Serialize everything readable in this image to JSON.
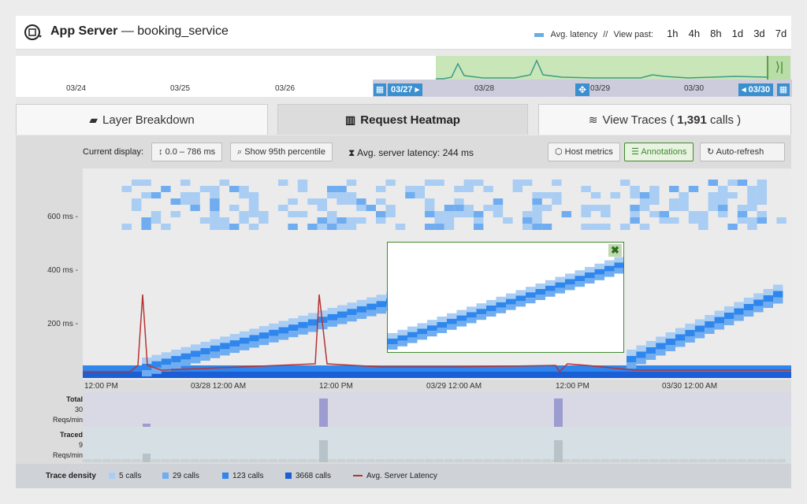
{
  "header": {
    "app_name": "App Server",
    "service": "booking_service",
    "legend_label": "Avg. latency",
    "separator": "//",
    "view_past_label": "View past:",
    "ranges": [
      "1h",
      "4h",
      "8h",
      "1d",
      "3d",
      "7d"
    ]
  },
  "timeline": {
    "dates": [
      "03/24",
      "03/25",
      "03/26",
      "03/28",
      "03/29",
      "03/30"
    ],
    "start_tag": "03/27",
    "end_tag": "03/30",
    "handle_glyph": "⟩|",
    "accent": "#3a8fcf",
    "selection_color": "#c8e6b8"
  },
  "tabs": [
    {
      "label": "Layer Breakdown",
      "icon": "layers-icon"
    },
    {
      "label": "Request Heatmap",
      "icon": "heatmap-icon"
    },
    {
      "label": "View Traces ( ",
      "count": "1,391",
      "suffix": " calls )",
      "icon": "traces-icon"
    }
  ],
  "toolbar": {
    "current_display_label": "Current display:",
    "range_value": "0.0 – 786 ms",
    "percentile_btn": "Show 95th percentile",
    "avg_latency_text": "Avg. server latency: 244 ms",
    "host_metrics_btn": "Host metrics",
    "annotations_btn": "Annotations",
    "auto_refresh_btn": "Auto-refresh"
  },
  "heatmap": {
    "y_ticks": [
      "600 ms -",
      "400 ms -",
      "200 ms -"
    ],
    "x_ticks": [
      "12:00 PM",
      "03/28 12:00 AM",
      "12:00 PM",
      "03/29 12:00 AM",
      "12:00 PM",
      "03/30 12:00 AM"
    ],
    "close_glyph": "✖",
    "line_color": "#b83232"
  },
  "strips": {
    "total_title": "Total",
    "total_value": "30",
    "total_unit": "Reqs/min",
    "traced_title": "Traced",
    "traced_value": "9",
    "traced_unit": "Reqs/min"
  },
  "legend": {
    "title": "Trace density",
    "items": [
      {
        "label": "5 calls",
        "color": "#a9cdf3"
      },
      {
        "label": "29 calls",
        "color": "#6fadf0"
      },
      {
        "label": "123 calls",
        "color": "#2f86ec"
      },
      {
        "label": "3668 calls",
        "color": "#1a5fd6"
      }
    ],
    "line_label": "Avg. Server Latency"
  }
}
